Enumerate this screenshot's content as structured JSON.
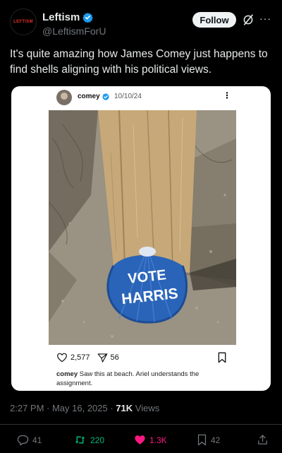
{
  "author": {
    "name": "Leftism",
    "handle": "@LeftismForU",
    "avatar_text": "LEFTISM"
  },
  "follow_label": "Follow",
  "more_icon": "···",
  "tweet": {
    "text": "It's quite amazing how James Comey just happens to find shells aligning with his political views."
  },
  "embedded_post": {
    "user": "comey",
    "date": "10/10/24",
    "more_icon": "⋮",
    "likes": "2,577",
    "shares": "56",
    "caption_user": "comey",
    "caption_text": "Saw this at beach. Ariel understands the assignment.",
    "shell_text_line1": "VOTE",
    "shell_text_line2": "HARRIS"
  },
  "meta": {
    "time_date": "2:27 PM · May 16, 2025 · ",
    "views_count": "71K",
    "views_label": " Views"
  },
  "stats": {
    "replies": "41",
    "reposts": "220",
    "likes": "1.3K",
    "bookmarks": "42"
  },
  "colors": {
    "background": "#000000",
    "verified": "#1d9bf0",
    "repost": "#00ba7c",
    "like": "#f91880",
    "muted": "#71767b"
  }
}
